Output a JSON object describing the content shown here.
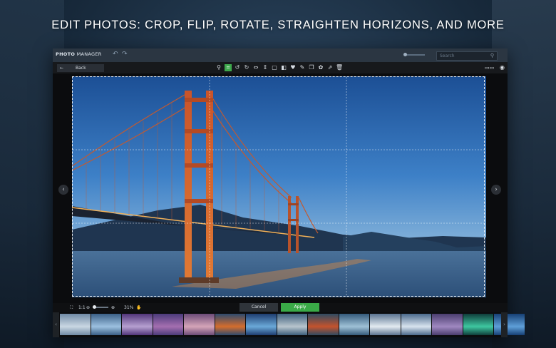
{
  "headline": "EDIT PHOTOS: CROP, FLIP, ROTATE, STRAIGHTEN HORIZONS, AND MORE",
  "app": {
    "title_bold": "PHOTO",
    "title_rest": " MANAGER",
    "undo_icon": "undo-icon",
    "redo_icon": "redo-icon",
    "search_placeholder": "Search"
  },
  "toolbar": {
    "back_label": "Back",
    "tools": [
      {
        "name": "magic-wand-icon",
        "glyph": "⚲"
      },
      {
        "name": "crop-icon",
        "glyph": "⌗",
        "active": true
      },
      {
        "name": "rotate-left-icon",
        "glyph": "↺"
      },
      {
        "name": "rotate-right-icon",
        "glyph": "↻"
      },
      {
        "name": "flip-horizontal-icon",
        "glyph": "⇔"
      },
      {
        "name": "flip-vertical-icon",
        "glyph": "⇕"
      },
      {
        "name": "frame-icon",
        "glyph": "▢"
      },
      {
        "name": "adjust-icon",
        "glyph": "◧"
      },
      {
        "name": "heart-icon",
        "glyph": "♥"
      },
      {
        "name": "tag-icon",
        "glyph": "✎"
      },
      {
        "name": "copy-icon",
        "glyph": "❐"
      },
      {
        "name": "palette-icon",
        "glyph": "✿"
      },
      {
        "name": "share-icon",
        "glyph": "⇗"
      },
      {
        "name": "trash-icon",
        "glyph": "🗑"
      }
    ],
    "right_tools": [
      {
        "name": "compare-icon",
        "glyph": "▭▭"
      },
      {
        "name": "eye-icon",
        "glyph": "◉"
      }
    ]
  },
  "bottom": {
    "fit_label": "1:1",
    "zoom_percent": "31%",
    "cancel_label": "Cancel",
    "apply_label": "Apply"
  },
  "filmstrip": {
    "thumbs": [
      {
        "name": "thumb-river-city",
        "c1": "#6f8aa5",
        "c2": "#c9d7e3"
      },
      {
        "name": "thumb-lake-dusk",
        "c1": "#3a5f86",
        "c2": "#9cc0df"
      },
      {
        "name": "thumb-purple-sky",
        "c1": "#51357a",
        "c2": "#b6a0d0"
      },
      {
        "name": "thumb-violet-sea",
        "c1": "#4b3b7b",
        "c2": "#a46fb0"
      },
      {
        "name": "thumb-pink-coast",
        "c1": "#6c4b78",
        "c2": "#d5a4b8"
      },
      {
        "name": "thumb-golden-bridge",
        "c1": "#2d4a6e",
        "c2": "#d46d2d"
      },
      {
        "name": "thumb-blue-lights",
        "c1": "#1e3d70",
        "c2": "#6aa9d8"
      },
      {
        "name": "thumb-boats",
        "c1": "#3d5e7c",
        "c2": "#b8c5cd"
      },
      {
        "name": "thumb-red-boat",
        "c1": "#2f4a61",
        "c2": "#c4532d"
      },
      {
        "name": "thumb-cliffs",
        "c1": "#345a7a",
        "c2": "#9fc1d6"
      },
      {
        "name": "thumb-snow-cabin",
        "c1": "#5a7390",
        "c2": "#e3ebf1"
      },
      {
        "name": "thumb-ice-pier",
        "c1": "#4b6a8c",
        "c2": "#d8e3ee"
      },
      {
        "name": "thumb-purple-rock",
        "c1": "#4a3d6e",
        "c2": "#9f88c0"
      },
      {
        "name": "thumb-aurora",
        "c1": "#0f3d3a",
        "c2": "#3ec7a0"
      },
      {
        "name": "thumb-blue-bridge",
        "c1": "#163f74",
        "c2": "#5e9fd8"
      }
    ]
  }
}
